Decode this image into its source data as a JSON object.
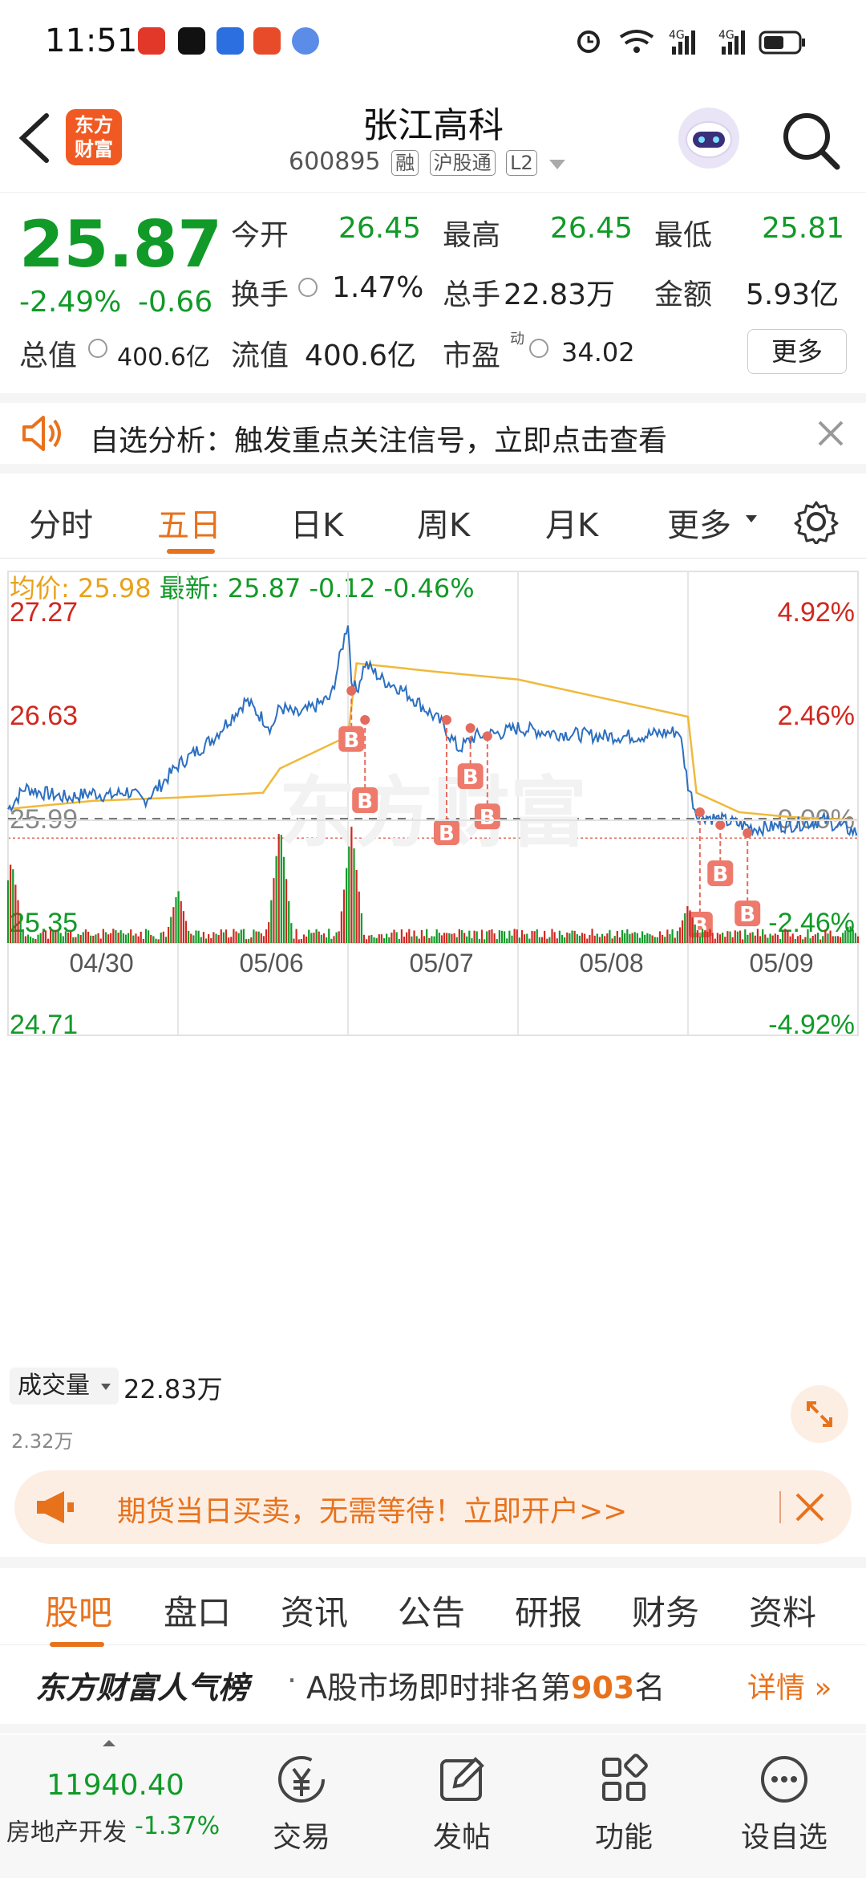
{
  "status_bar": {
    "time": "11:51",
    "signal1": "4G",
    "signal2": "4G"
  },
  "header": {
    "stock_name": "张江高科",
    "stock_code": "600895",
    "tags": [
      "融",
      "沪股通",
      "L2"
    ],
    "logo_text_line1": "东方",
    "logo_text_line2": "财富"
  },
  "quote": {
    "price": "25.87",
    "change_pct": "-2.49%",
    "change": "-0.66",
    "open_label": "今开",
    "open": "26.45",
    "high_label": "最高",
    "high": "26.45",
    "low_label": "最低",
    "low": "25.81",
    "turnover_label": "换手",
    "turnover": "1.47%",
    "volume_label": "总手",
    "volume": "22.83万",
    "amount_label": "金额",
    "amount": "5.93亿",
    "mktcap_label": "总值",
    "mktcap": "400.6亿",
    "float_label": "流值",
    "float": "400.6亿",
    "pe_label": "市盈",
    "pe_sup": "动",
    "pe": "34.02",
    "more_label": "更多"
  },
  "notice": {
    "text": "自选分析：触发重点关注信号，立即点击查看"
  },
  "chart_tabs": [
    {
      "label": "分时"
    },
    {
      "label": "五日"
    },
    {
      "label": "日K"
    },
    {
      "label": "周K"
    },
    {
      "label": "月K"
    },
    {
      "label": "更多"
    }
  ],
  "chart_info": {
    "avg_label": "均价:",
    "avg_value": "25.98",
    "latest_label": "最新:",
    "latest_value": "25.87",
    "latest_change": "-0.12",
    "latest_pct": "-0.46%",
    "volume_selector": "成交量",
    "volume_total": "22.83万",
    "volume_max_label": "2.32万"
  },
  "chart_data": {
    "type": "line",
    "title": "",
    "x_dates": [
      "04/30",
      "05/06",
      "05/07",
      "05/08",
      "05/09"
    ],
    "y_ticks": [
      "27.27",
      "26.63",
      "25.99",
      "25.35",
      "24.71"
    ],
    "y_pct_ticks": [
      "4.92%",
      "2.46%",
      "0.00%",
      "-2.46%",
      "-4.92%"
    ],
    "ylim": [
      24.71,
      27.27
    ],
    "prev_close": 25.99,
    "latest": 25.87,
    "series": [
      {
        "kind": "price",
        "x": [
          0,
          0.1,
          0.2,
          0.35,
          0.5,
          0.6,
          0.7,
          0.8,
          0.9,
          1.0,
          1.2,
          1.4,
          1.55,
          1.6,
          1.7,
          1.8,
          1.9,
          2.0,
          2.02,
          2.05,
          2.1,
          2.2,
          2.3,
          2.4,
          2.55,
          2.65,
          2.75,
          2.9,
          3.0,
          3.2,
          3.5,
          3.7,
          3.95,
          4.0,
          4.05,
          4.2,
          4.4,
          4.6,
          4.8,
          5.0
        ],
        "y": [
          26.05,
          26.18,
          26.15,
          26.12,
          26.15,
          26.13,
          26.16,
          26.1,
          26.2,
          26.32,
          26.48,
          26.72,
          26.55,
          26.68,
          26.63,
          26.68,
          26.74,
          27.21,
          26.85,
          26.78,
          26.95,
          26.85,
          26.8,
          26.72,
          26.58,
          26.42,
          26.5,
          26.52,
          26.55,
          26.52,
          26.5,
          26.5,
          26.53,
          26.2,
          26.02,
          25.98,
          25.93,
          25.95,
          25.98,
          25.9
        ]
      },
      {
        "kind": "average",
        "x": [
          0,
          0.5,
          1.0,
          1.5,
          1.6,
          2.0,
          2.05,
          2.5,
          3.0,
          4.0,
          4.05,
          4.3,
          4.6,
          5.0
        ],
        "y": [
          26.05,
          26.1,
          26.12,
          26.15,
          26.3,
          26.5,
          26.95,
          26.9,
          26.85,
          26.62,
          26.15,
          26.03,
          26.0,
          25.98
        ]
      }
    ],
    "buy_markers": [
      {
        "x": 2.02,
        "y": 26.78
      },
      {
        "x": 2.1,
        "y": 26.6
      },
      {
        "x": 2.58,
        "y": 26.6
      },
      {
        "x": 2.72,
        "y": 26.55
      },
      {
        "x": 2.82,
        "y": 26.5
      },
      {
        "x": 4.07,
        "y": 26.03
      },
      {
        "x": 4.19,
        "y": 25.95
      },
      {
        "x": 4.35,
        "y": 25.9
      }
    ],
    "marker_label": "B",
    "volume_peaks": [
      {
        "x": 0.02,
        "v": 0.7
      },
      {
        "x": 1.0,
        "v": 0.45
      },
      {
        "x": 1.6,
        "v": 1.0
      },
      {
        "x": 2.02,
        "v": 0.98
      },
      {
        "x": 4.0,
        "v": 0.32
      },
      {
        "x": 4.95,
        "v": 0.15
      }
    ]
  },
  "futures_banner": {
    "text": "期货当日买卖，无需等待！立即开户>>"
  },
  "bottom_tabs": [
    {
      "label": "股吧"
    },
    {
      "label": "盘口"
    },
    {
      "label": "资讯"
    },
    {
      "label": "公告"
    },
    {
      "label": "研报"
    },
    {
      "label": "财务"
    },
    {
      "label": "资料"
    }
  ],
  "ranking": {
    "brand": "东方财富人气榜",
    "prefix": "A股市场即时排名第",
    "rank": "903",
    "suffix": "名",
    "detail": "详情"
  },
  "toolbar": {
    "index_value": "11940.40",
    "index_name": "房地产开发",
    "index_change": "-1.37%",
    "items": [
      {
        "label": "交易"
      },
      {
        "label": "发帖"
      },
      {
        "label": "功能"
      },
      {
        "label": "设自选"
      }
    ]
  },
  "colors": {
    "up": "#d0281f",
    "down": "#119a28",
    "accent": "#e8721c",
    "price_line": "#2c6fc0",
    "avg_line": "#f0b93a"
  }
}
